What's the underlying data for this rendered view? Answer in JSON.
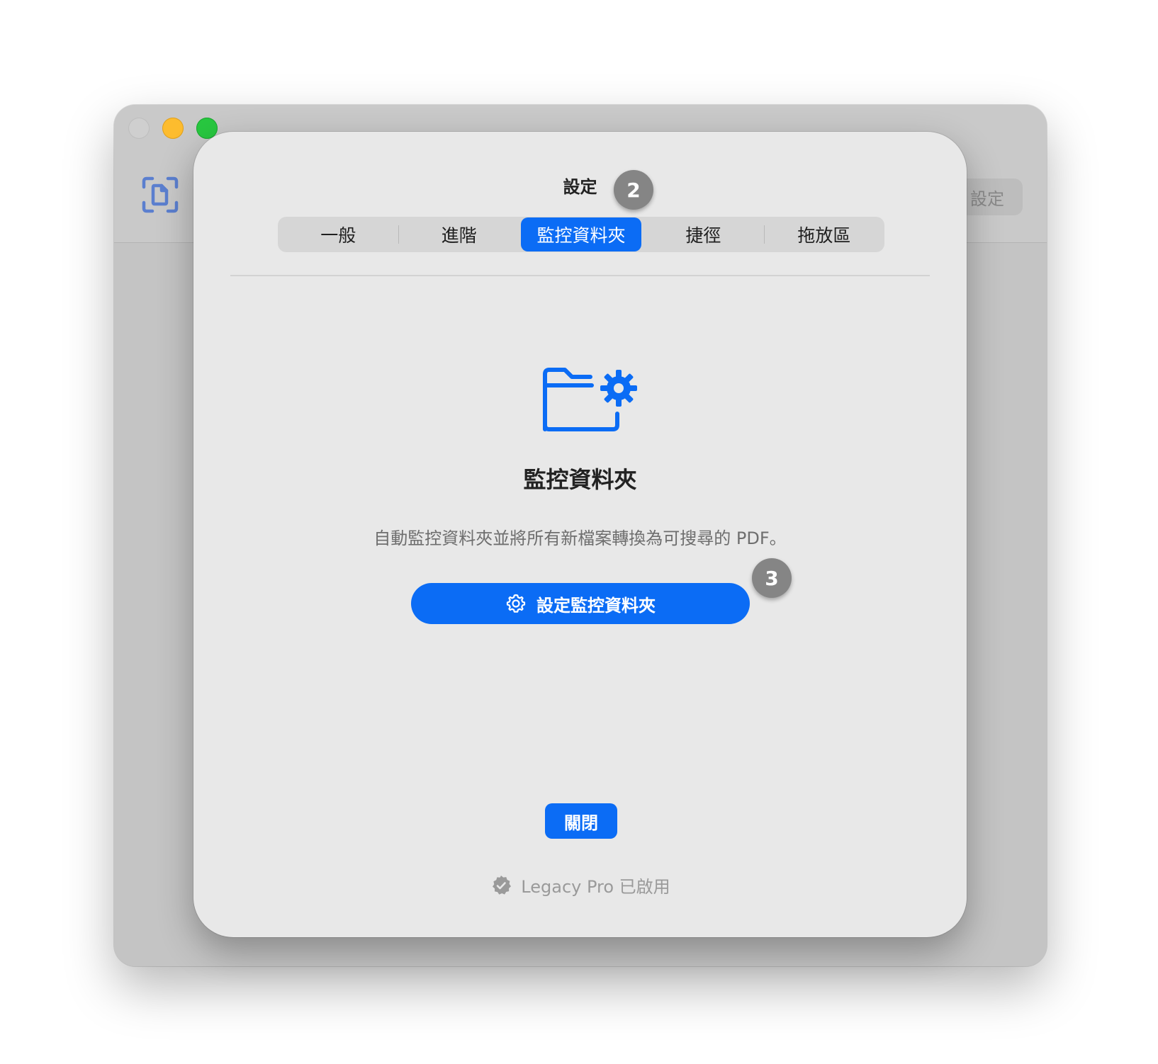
{
  "background_window": {
    "settings_button_label": "設定"
  },
  "sheet": {
    "title": "設定",
    "tabs": [
      {
        "label": "一般"
      },
      {
        "label": "進階"
      },
      {
        "label": "監控資料夾"
      },
      {
        "label": "捷徑"
      },
      {
        "label": "拖放區"
      }
    ],
    "active_tab_index": 2,
    "hero_title": "監控資料夾",
    "description": "自動監控資料夾並將所有新檔案轉換為可搜尋的 PDF。",
    "setup_button_label": "設定監控資料夾",
    "close_button_label": "關閉",
    "license_text": "Legacy Pro 已啟用"
  },
  "annotations": {
    "step_2": "2",
    "step_3": "3"
  },
  "colors": {
    "accent": "#0b6cf5",
    "badge": "#858585",
    "traffic_min": "#fdbc2e",
    "traffic_max": "#28c840"
  },
  "icons": {
    "app": "doc-scan-icon",
    "hero": "folder-gear-icon",
    "button": "gear-icon",
    "license": "checkmark-seal-icon"
  }
}
